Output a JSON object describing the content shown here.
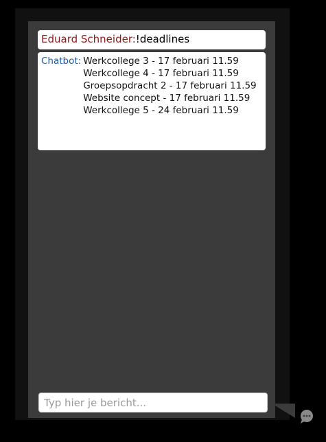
{
  "chat": {
    "messages": [
      {
        "sender": "Eduard Schneider:",
        "text": "!deadlines"
      },
      {
        "sender": "Chatbot:",
        "lines": [
          "Werkcollege 3 - 17 februari 11.59",
          "Werkcollege 4 - 17 februari 11.59",
          "Groepsopdracht 2 - 17 februari 11.59",
          "Website concept - 17 februari 11.59",
          "Werkcollege 5 - 24 februari 11.59"
        ]
      }
    ],
    "input": {
      "placeholder": "Typ hier je bericht...",
      "value": ""
    }
  },
  "colors": {
    "page_background": "#000000",
    "panel_background": "#3b3b3b",
    "user_name": "#8b1a1a",
    "bot_name": "#1f5a9c",
    "bubble_background": "#ffffff"
  },
  "icons": {
    "chat_toggle": "speech-bubble-icon"
  }
}
